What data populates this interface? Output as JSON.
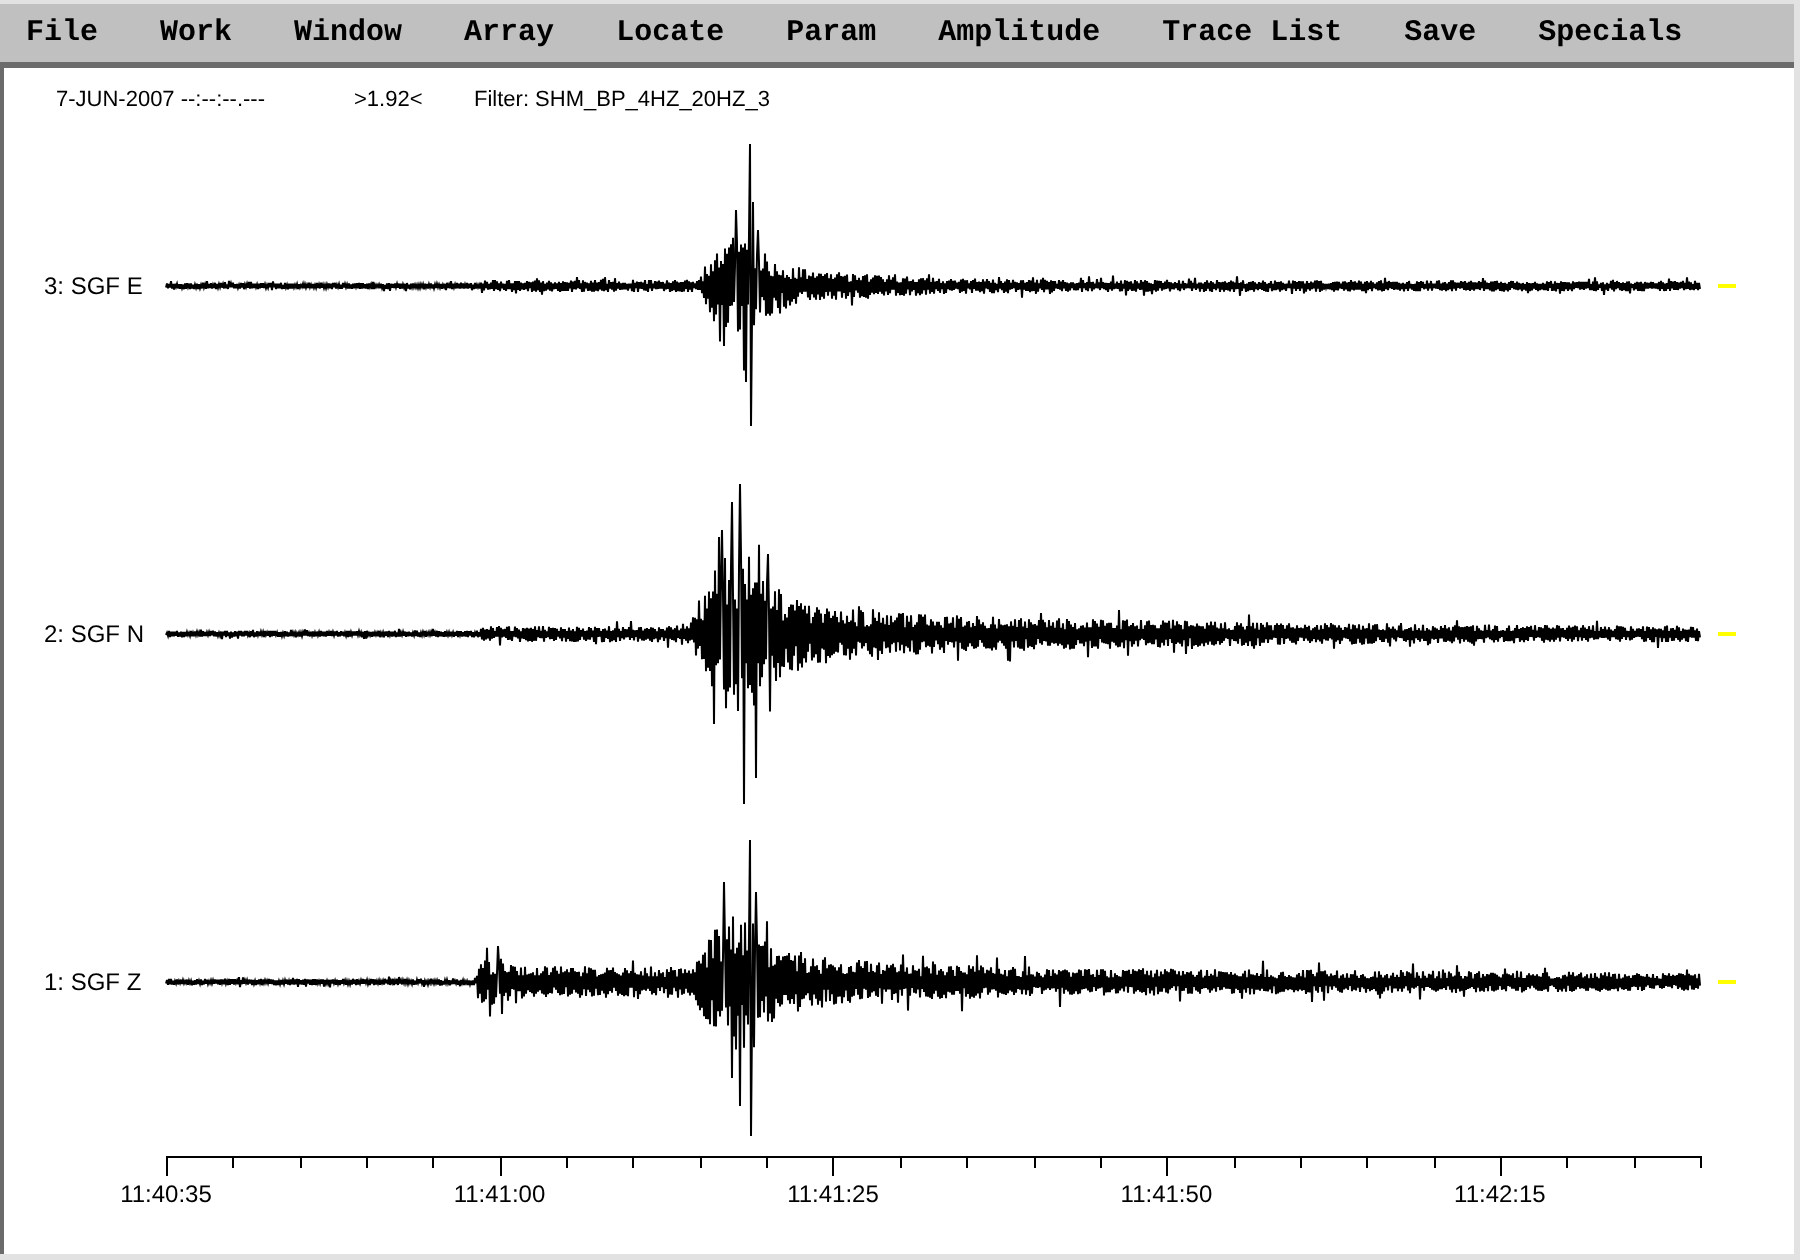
{
  "menu": [
    "File",
    "Work",
    "Window",
    "Array",
    "Locate",
    "Param",
    "Amplitude",
    "Trace List",
    "Save",
    "Specials"
  ],
  "header": {
    "date_time": "7-JUN-2007 --:--:--.---",
    "scale": ">1.92<",
    "filter": "Filter: SHM_BP_4HZ_20HZ_3"
  },
  "traces": [
    {
      "label": "3: SGF E"
    },
    {
      "label": "2: SGF N"
    },
    {
      "label": "1: SGF Z"
    }
  ],
  "time_axis": {
    "ticks": [
      "11:40:35",
      "11:41:00",
      "11:41:25",
      "11:41:50",
      "11:42:15"
    ]
  }
}
